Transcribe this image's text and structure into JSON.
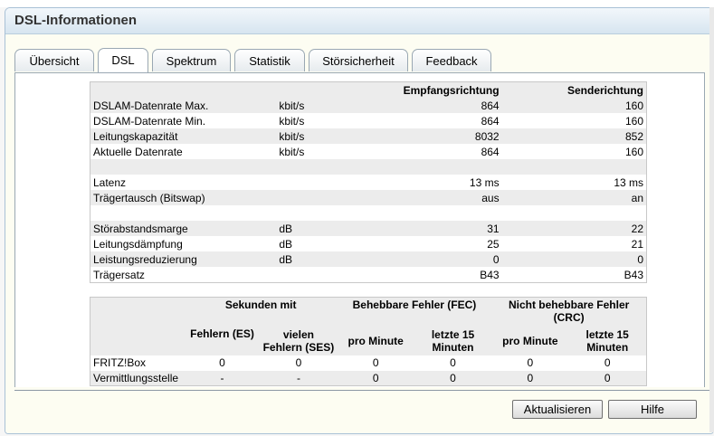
{
  "window": {
    "title": "DSL-Informationen"
  },
  "tabs": [
    {
      "label": "Übersicht",
      "active": false
    },
    {
      "label": "DSL",
      "active": true
    },
    {
      "label": "Spektrum",
      "active": false
    },
    {
      "label": "Statistik",
      "active": false
    },
    {
      "label": "Störsicherheit",
      "active": false
    },
    {
      "label": "Feedback",
      "active": false
    }
  ],
  "info_table": {
    "headers": [
      "",
      "",
      "Empfangsrichtung",
      "Senderichtung"
    ],
    "rows": [
      [
        "DSLAM-Datenrate Max.",
        "kbit/s",
        "864",
        "160"
      ],
      [
        "DSLAM-Datenrate Min.",
        "kbit/s",
        "864",
        "160"
      ],
      [
        "Leitungskapazität",
        "kbit/s",
        "8032",
        "852"
      ],
      [
        "Aktuelle Datenrate",
        "kbit/s",
        "864",
        "160"
      ],
      [
        "",
        "",
        "",
        ""
      ],
      [
        "Latenz",
        "",
        "13 ms",
        "13 ms"
      ],
      [
        "Trägertausch (Bitswap)",
        "",
        "aus",
        "an"
      ],
      [
        "",
        "",
        "",
        ""
      ],
      [
        "Störabstandsmarge",
        "dB",
        "31",
        "22"
      ],
      [
        "Leitungsdämpfung",
        "dB",
        "25",
        "21"
      ],
      [
        "Leistungsreduzierung",
        "dB",
        "0",
        "0"
      ],
      [
        "Trägersatz",
        "",
        "B43",
        "B43"
      ]
    ]
  },
  "error_table": {
    "group_headers": [
      "Sekunden mit",
      "Behebbare Fehler (FEC)",
      "Nicht behebbare Fehler (CRC)"
    ],
    "sub_headers": [
      "Fehlern (ES)",
      "vielen Fehlern (SES)",
      "pro Minute",
      "letzte 15 Minuten",
      "pro Minute",
      "letzte 15 Minuten"
    ],
    "rows": [
      [
        "FRITZ!Box",
        "0",
        "0",
        "0",
        "0",
        "0",
        "0"
      ],
      [
        "Vermittlungsstelle",
        "-",
        "-",
        "0",
        "0",
        "0",
        "0"
      ]
    ]
  },
  "buttons": {
    "refresh": "Aktualisieren",
    "help": "Hilfe"
  }
}
